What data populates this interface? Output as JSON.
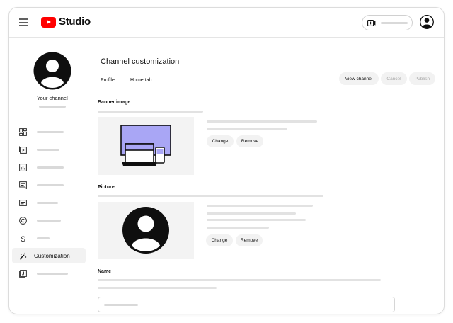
{
  "header": {
    "logo_text": "Studio",
    "menu_icon": "hamburger-menu-icon",
    "create_icon": "create-video-icon",
    "account_icon": "account-avatar-icon",
    "brand_color": "#ff0000"
  },
  "sidebar": {
    "channel_label": "Your channel",
    "items": [
      {
        "icon": "dashboard-icon"
      },
      {
        "icon": "content-icon"
      },
      {
        "icon": "analytics-icon"
      },
      {
        "icon": "comments-icon"
      },
      {
        "icon": "subtitles-icon"
      },
      {
        "icon": "copyright-icon"
      },
      {
        "icon": "earn-icon"
      },
      {
        "icon": "customization-icon",
        "label": "Customization",
        "active": true
      },
      {
        "icon": "audio-library-icon"
      }
    ]
  },
  "main": {
    "title": "Channel customization",
    "tabs": [
      {
        "label": "Profile",
        "active": true
      },
      {
        "label": "Home tab",
        "active": false
      }
    ],
    "actions": {
      "view_channel": "View channel",
      "cancel": "Cancel",
      "publish": "Publish"
    },
    "banner": {
      "label": "Banner image",
      "change": "Change",
      "remove": "Remove",
      "accent_color": "#a9a6f5"
    },
    "picture": {
      "label": "Picture",
      "change": "Change",
      "remove": "Remove"
    },
    "name": {
      "label": "Name"
    }
  }
}
